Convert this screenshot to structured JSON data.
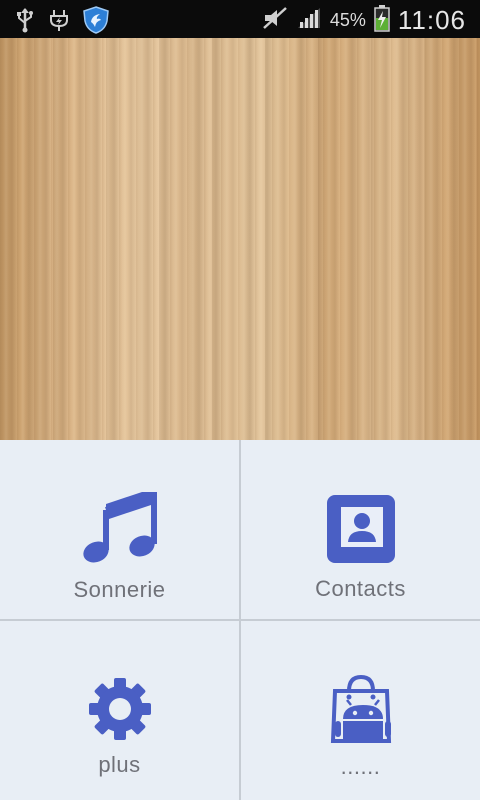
{
  "status_bar": {
    "battery_percent": "45%",
    "time": "11:06",
    "icons": [
      "usb-icon",
      "charging-plug-icon",
      "shield-app-icon",
      "mute-icon",
      "signal-icon",
      "battery-charging-icon"
    ]
  },
  "background": {
    "image": "wood-texture"
  },
  "menu": {
    "tiles": [
      {
        "label": "Sonnerie",
        "icon": "music-note-icon"
      },
      {
        "label": "Contacts",
        "icon": "contacts-icon"
      },
      {
        "label": "plus",
        "icon": "gear-icon"
      },
      {
        "label": "......",
        "icon": "android-shopping-bag-icon"
      }
    ]
  },
  "colors": {
    "accent": "#4a5fc4",
    "tile_bg": "#e8eef5",
    "label": "#6f7178",
    "status_bar": "#0b0b0b"
  }
}
